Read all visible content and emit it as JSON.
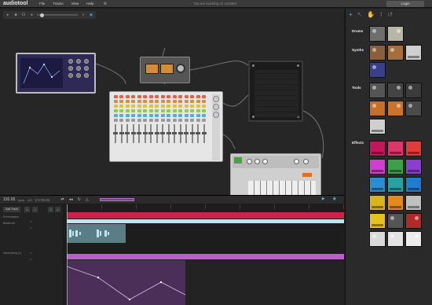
{
  "app": {
    "name": "audiotool"
  },
  "menu": {
    "items": [
      "File",
      "Tracks",
      "View",
      "Help"
    ]
  },
  "status": {
    "text": "You are working on Untitled"
  },
  "login": {
    "label": "Login"
  },
  "library": {
    "categories": [
      "Drums",
      "Synths",
      "Tools",
      "Effects"
    ]
  },
  "tracker": {
    "bpm": "120.00",
    "bpm_unit": "bpm",
    "signature": "4/4",
    "position": "1:1:01:01",
    "add_track": "Add Track",
    "tracks": [
      {
        "name": "Pulverisateur"
      },
      {
        "name": "Beatbox8"
      },
      {
        "name": "Heisenberg (1)"
      }
    ]
  },
  "colors": {
    "accent": "#3fb8e8",
    "clip_red": "#cd2149",
    "clip_purple": "#c25bd1",
    "clip_cyan": "#5a7e86"
  }
}
